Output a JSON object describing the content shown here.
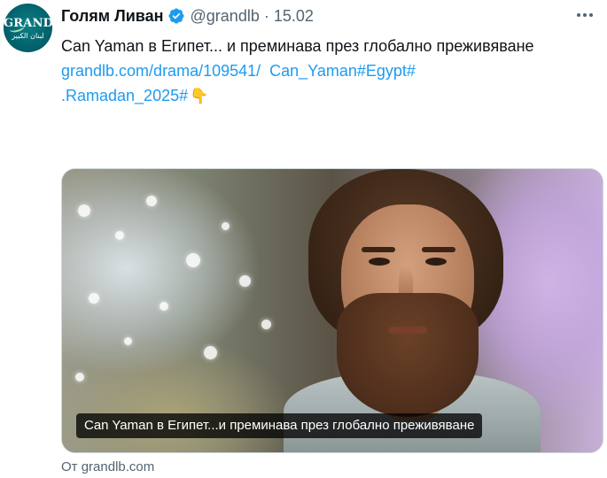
{
  "account": {
    "display_name": "Голям Ливан",
    "handle": "@grandlb",
    "date": "15.02",
    "verified": true,
    "avatar_text": "GRAND",
    "avatar_subtext": "لبنان الكبير"
  },
  "icons": {
    "verified": "verified-badge-icon",
    "more": "more-options-icon",
    "emoji": "backhand-index-pointing-down"
  },
  "tweet": {
    "text_line1": "Can Yaman в Египет... и преминава през глобално преживяване",
    "link_url": "grandlb.com/drama/109541/",
    "hashtags_line2": "Can_Yaman#Egypt#",
    "hashtags_line3": ".Ramadan_2025#",
    "emoji": "👇"
  },
  "media_card": {
    "caption": "Can Yaman в Египет...и преминава през глобално преживяване"
  },
  "source": {
    "label": "От grandlb.com"
  },
  "colors": {
    "link": "#1d9bf0",
    "verified": "#1d9bf0",
    "secondary_text": "#536471",
    "avatar_bg": "#03606a"
  }
}
